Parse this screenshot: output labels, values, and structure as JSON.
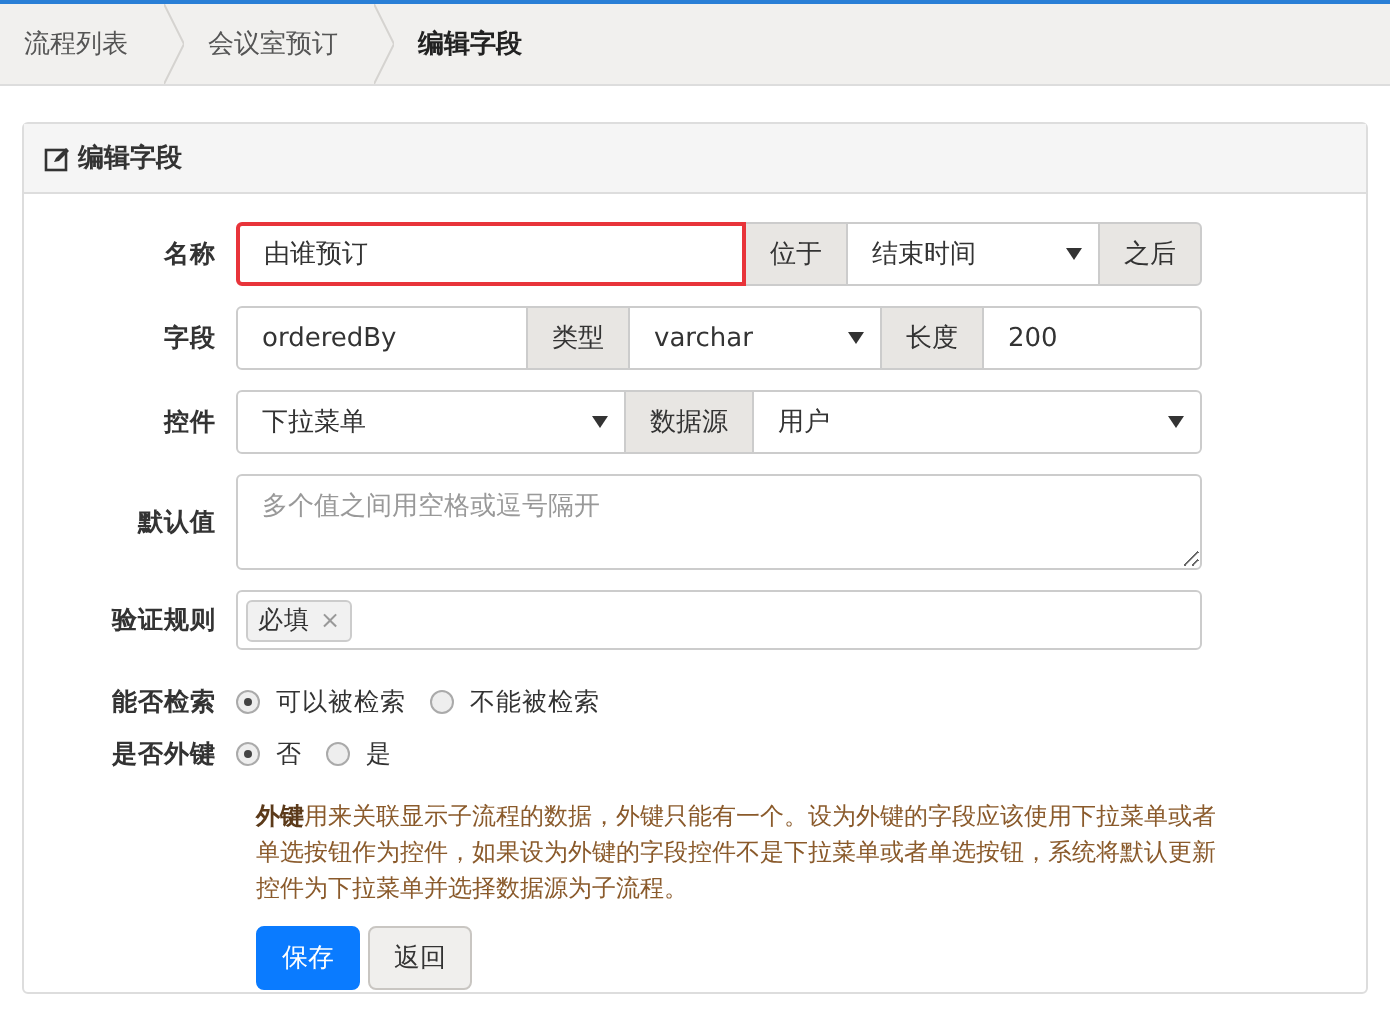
{
  "breadcrumbs": [
    {
      "label": "流程列表",
      "current": false
    },
    {
      "label": "会议室预订",
      "current": false
    },
    {
      "label": "编辑字段",
      "current": true
    }
  ],
  "panel": {
    "title": "编辑字段"
  },
  "rows": [
    {
      "kind": "group",
      "label": "名称",
      "parts": [
        {
          "kind": "input",
          "value": "由谁预订",
          "highlighted": true
        },
        {
          "kind": "addon",
          "text": "位于"
        },
        {
          "kind": "select",
          "value": "结束时间"
        },
        {
          "kind": "addon",
          "text": "之后"
        }
      ]
    },
    {
      "kind": "group",
      "label": "字段",
      "parts": [
        {
          "kind": "input",
          "value": "orderedBy",
          "highlighted": false
        },
        {
          "kind": "addon",
          "text": "类型"
        },
        {
          "kind": "select",
          "value": "varchar"
        },
        {
          "kind": "addon",
          "text": "长度"
        },
        {
          "kind": "input",
          "value": "200",
          "highlighted": false
        }
      ]
    },
    {
      "kind": "group",
      "label": "控件",
      "parts": [
        {
          "kind": "select",
          "value": "下拉菜单"
        },
        {
          "kind": "addon",
          "text": "数据源"
        },
        {
          "kind": "select",
          "value": "用户"
        }
      ]
    },
    {
      "kind": "textarea",
      "label": "默认值",
      "placeholder": "多个值之间用空格或逗号隔开"
    },
    {
      "kind": "tags",
      "label": "验证规则",
      "tags": [
        {
          "text": "必填",
          "remove": "×"
        }
      ]
    },
    {
      "kind": "radio",
      "label": "能否检索",
      "options": [
        {
          "label": "可以被检索",
          "selected": true
        },
        {
          "label": "不能被检索",
          "selected": false
        }
      ]
    },
    {
      "kind": "radio",
      "label": "是否外键",
      "options": [
        {
          "label": "否",
          "selected": true
        },
        {
          "label": "是",
          "selected": false
        }
      ]
    }
  ],
  "note": "**外键**用来关联显示子流程的数据，外键只能有一个。设为外键的字段应该使用下拉菜单或者单选按钮作为控件，如果设为外键的字段控件不是下拉菜单或者单选按钮，系统将默认更新控件为下拉菜单并选择数据源为子流程。",
  "buttons": [
    {
      "label": "保存",
      "primary": true
    },
    {
      "label": "返回",
      "primary": false
    }
  ]
}
